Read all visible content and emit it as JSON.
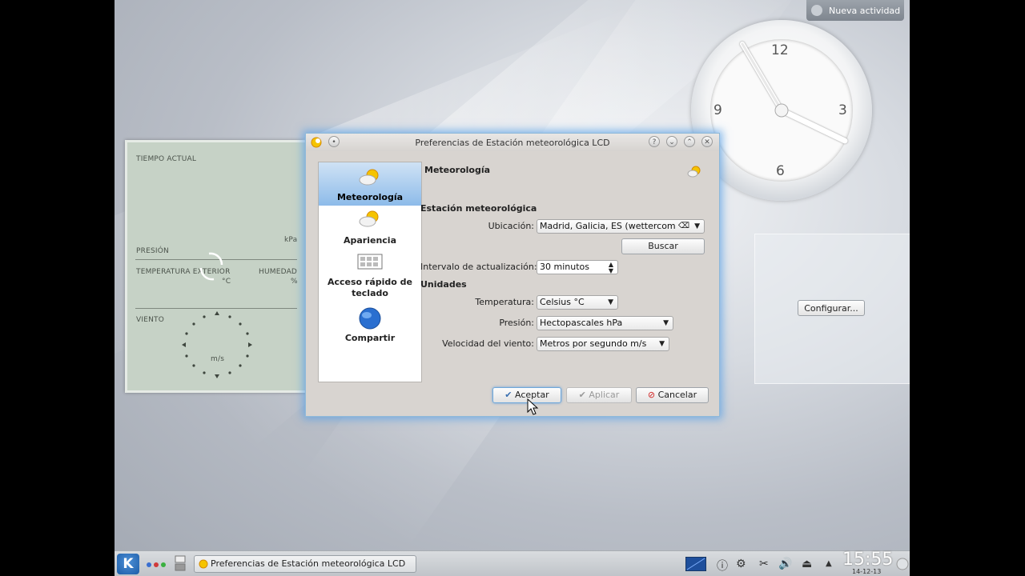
{
  "desktop": {
    "new_activity": "Nueva actividad",
    "configure_button": "Configurar..."
  },
  "clock_widget": {
    "numbers": {
      "n12": "12",
      "n3": "3",
      "n6": "6",
      "n9": "9"
    }
  },
  "weather_widget": {
    "current": "TIEMPO ACTUAL",
    "pressure": "PRESIÓN",
    "pressure_unit": "kPa",
    "outside_temp": "TEMPERATURA EXTERIOR",
    "temp_unit": "°C",
    "humidity": "HUMEDAD",
    "humidity_unit": "%",
    "wind": "VIENTO",
    "wind_unit": "m/s"
  },
  "dialog": {
    "title": "Preferencias de Estación meteorológica LCD",
    "sidebar": [
      {
        "label": "Meteorología"
      },
      {
        "label": "Apariencia"
      },
      {
        "label": "Acceso rápido de teclado"
      },
      {
        "label": "Compartir"
      }
    ],
    "page_title": "Meteorología",
    "section_station": "Estación meteorológica",
    "location_label": "Ubicación:",
    "location_value": "Madrid, Galicia, ES (wettercom)",
    "search_button": "Buscar",
    "interval_label": "Intervalo de actualización:",
    "interval_value": "30 minutos",
    "section_units": "Unidades",
    "temperature_label": "Temperatura:",
    "temperature_value": "Celsius °C",
    "pressure_label": "Presión:",
    "pressure_value": "Hectopascales hPa",
    "wind_label": "Velocidad del viento:",
    "wind_value": "Metros por segundo m/s",
    "accept": "Aceptar",
    "apply": "Aplicar",
    "cancel": "Cancelar"
  },
  "taskbar": {
    "task_title": "Preferencias de Estación meteorológica LCD",
    "time": "15:55",
    "date": "14-12-13"
  }
}
